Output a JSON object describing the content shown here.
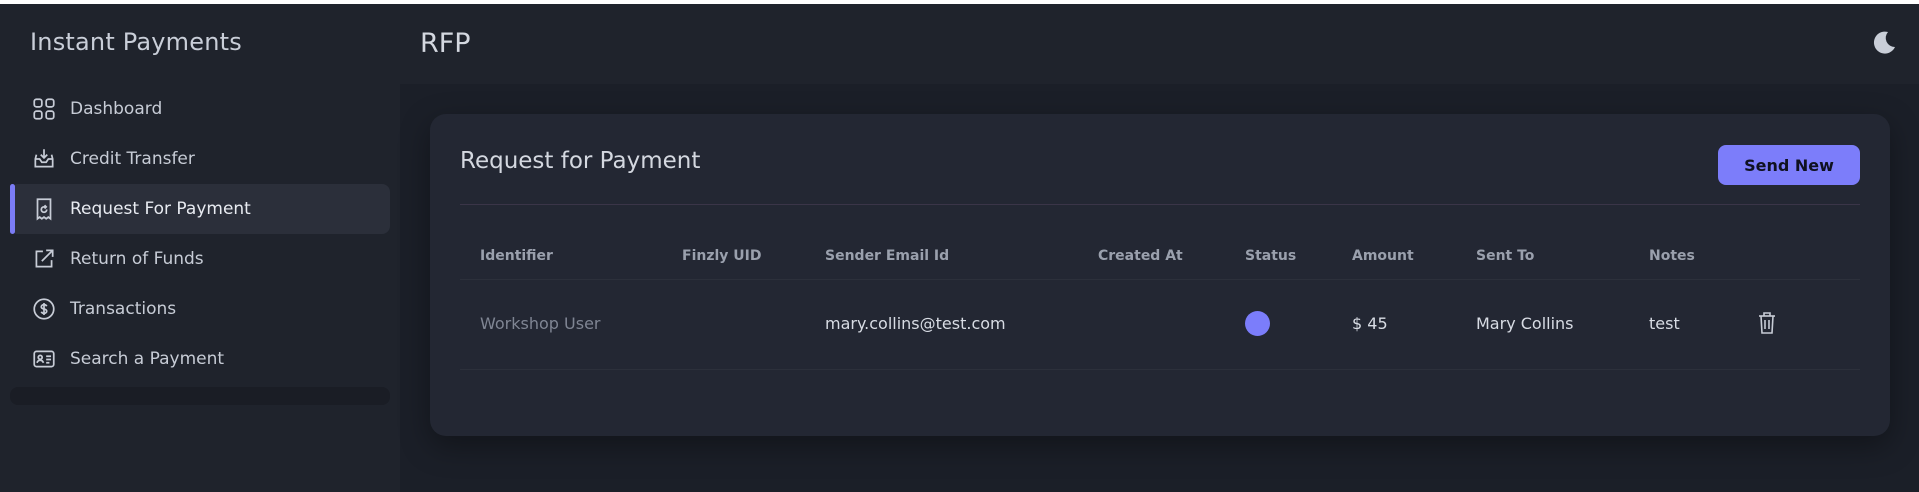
{
  "app": {
    "title": "Instant Payments"
  },
  "sidebar": {
    "items": [
      {
        "label": "Dashboard",
        "icon": "grid-icon"
      },
      {
        "label": "Credit Transfer",
        "icon": "inbox-download-icon"
      },
      {
        "label": "Request For Payment",
        "icon": "receipt-return-icon",
        "active": true
      },
      {
        "label": "Return of Funds",
        "icon": "external-link-icon"
      },
      {
        "label": "Transactions",
        "icon": "dollar-circle-icon"
      },
      {
        "label": "Search a Payment",
        "icon": "id-card-icon"
      }
    ]
  },
  "header": {
    "title": "RFP",
    "theme_toggle_icon": "moon-icon"
  },
  "card": {
    "title": "Request for Payment",
    "send_button": "Send New"
  },
  "table": {
    "columns": [
      "Identifier",
      "Finzly UID",
      "Sender Email Id",
      "Created At",
      "Status",
      "Amount",
      "Sent To",
      "Notes"
    ],
    "rows": [
      {
        "identifier": "Workshop User",
        "finzly_uid": "",
        "sender_email": "mary.collins@test.com",
        "created_at": "",
        "status_color": "#7b7dfb",
        "amount": "$ 45",
        "sent_to": "Mary Collins",
        "notes": "test",
        "action_icon": "trash-icon"
      }
    ]
  },
  "colors": {
    "accent": "#7c7dfa",
    "background": "#1b1f28",
    "card": "#232733"
  }
}
